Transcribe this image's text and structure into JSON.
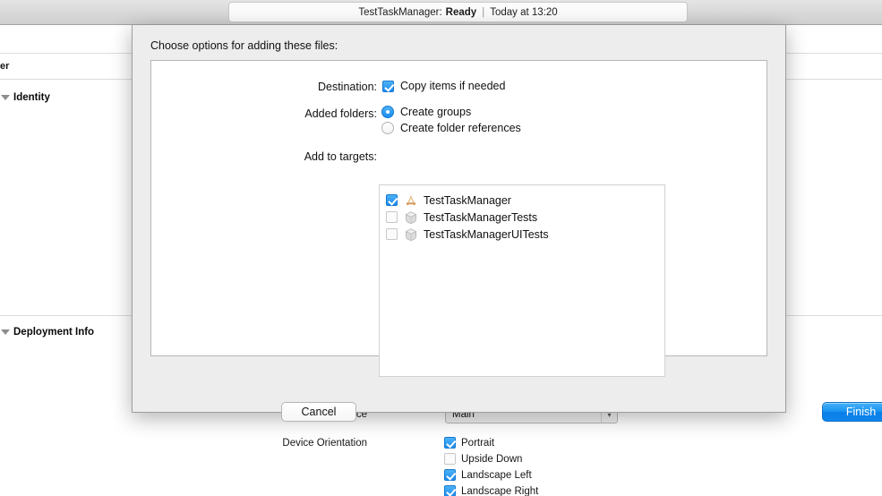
{
  "titlebar": {
    "status": {
      "project": "TestTaskManager:",
      "state": "Ready",
      "separator": "|",
      "time": "Today at 13:20"
    }
  },
  "background": {
    "clipped_text": "er",
    "sections": [
      {
        "label": "Identity"
      },
      {
        "label": "Deployment Info"
      }
    ],
    "main_interface": {
      "label": "Main Interface",
      "value": "Main",
      "arrow": "chevron-down"
    },
    "device_orientation": {
      "label": "Device Orientation",
      "options": [
        {
          "label": "Portrait",
          "checked": true
        },
        {
          "label": "Upside Down",
          "checked": false
        },
        {
          "label": "Landscape Left",
          "checked": true
        },
        {
          "label": "Landscape Right",
          "checked": true
        }
      ]
    }
  },
  "dialog": {
    "title": "Choose options for adding these files:",
    "destination": {
      "label": "Destination:",
      "option": {
        "label": "Copy items if needed",
        "checked": true
      }
    },
    "added_folders": {
      "label": "Added folders:",
      "options": [
        {
          "label": "Create groups",
          "selected": true
        },
        {
          "label": "Create folder references",
          "selected": false
        }
      ]
    },
    "add_to_targets": {
      "label": "Add to targets:",
      "targets": [
        {
          "name": "TestTaskManager",
          "checked": true,
          "icon": "xcode-app-target-icon"
        },
        {
          "name": "TestTaskManagerTests",
          "checked": false,
          "icon": "test-bundle-icon"
        },
        {
          "name": "TestTaskManagerUITests",
          "checked": false,
          "icon": "test-bundle-icon"
        }
      ]
    },
    "buttons": {
      "cancel": "Cancel",
      "finish": "Finish"
    }
  },
  "colors": {
    "accent_blue": "#1a8cf0",
    "finish_blue": "#0b7fe8",
    "sheet_bg": "#ededed",
    "titlebar_top": "#e4e4e4"
  }
}
